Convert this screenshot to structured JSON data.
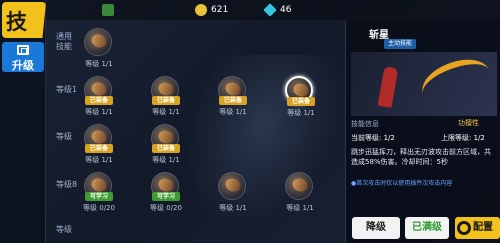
{
  "sidebar": {
    "title": "技能",
    "tab_upgrade": "升级"
  },
  "topbar": {
    "currency_1": "",
    "currency_2": "621",
    "currency_3": "46"
  },
  "rows": [
    {
      "label": "通用技能"
    },
    {
      "label": "等级1"
    },
    {
      "label": "等级"
    },
    {
      "label": "等级8"
    },
    {
      "label": "等级"
    }
  ],
  "skills": [
    {
      "tag": "",
      "level": "等级 1/1"
    },
    {
      "tag": "已装备",
      "level": "等级 1/1"
    },
    {
      "tag": "已装备",
      "level": "等级 1/1"
    },
    {
      "tag": "已装备",
      "level": "等级 1/1"
    },
    {
      "tag": "已装备",
      "level": "等级 1/1"
    },
    {
      "tag": "已装备",
      "level": "等级 1/1"
    },
    {
      "tag": "已装备",
      "level": "等级 1/1"
    },
    {
      "tag": "可学习",
      "level": "等级 0/20"
    },
    {
      "tag": "可学习",
      "level": "等级 0/20"
    },
    {
      "tag": "",
      "level": "等级 1/1"
    },
    {
      "tag": "",
      "level": "等级 1/1"
    }
  ],
  "panel": {
    "skill_name": "斩星",
    "skill_type": "主动技能",
    "info_header": "技能信息",
    "info_badge": "功擅性",
    "current_level": "当前等级: 1/2",
    "max_level": "上限等级: 1/2",
    "description": "跳步迅猛挥刀，释出无刃波攻击前方区域，共造成58%伤害。冷却时间：5秒",
    "note": "●首次攻击时仅以使用插件次攻击内容"
  },
  "buttons": {
    "downgrade": "降级",
    "max": "已满级",
    "config": "配置"
  }
}
